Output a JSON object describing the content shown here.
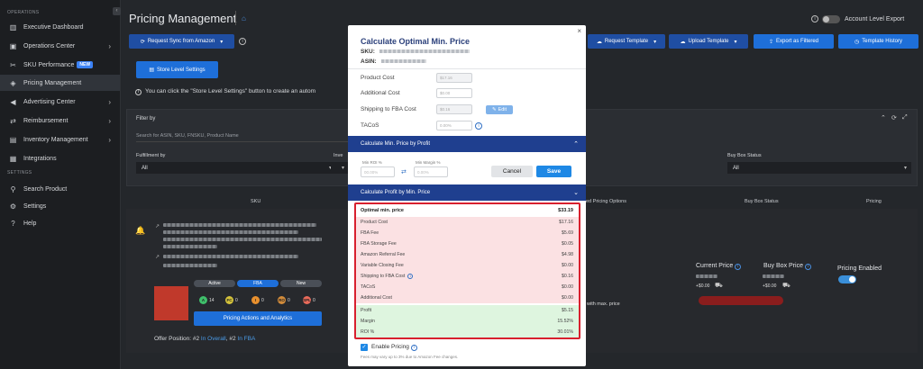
{
  "sidebar": {
    "section_operations": "OPERATIONS",
    "section_settings": "SETTINGS",
    "items": [
      {
        "label": "Executive Dashboard",
        "icon": "bar-chart-icon"
      },
      {
        "label": "Operations Center",
        "icon": "briefcase-icon"
      },
      {
        "label": "SKU Performance",
        "icon": "tag-icon",
        "badge": "NEW"
      },
      {
        "label": "Pricing Management",
        "icon": "price-tag-icon"
      },
      {
        "label": "Advertising Center",
        "icon": "megaphone-icon"
      },
      {
        "label": "Reimbursement",
        "icon": "exchange-icon"
      },
      {
        "label": "Inventory Management",
        "icon": "box-icon"
      },
      {
        "label": "Integrations",
        "icon": "grid-icon"
      },
      {
        "label": "Search Product",
        "icon": "search-icon"
      },
      {
        "label": "Settings",
        "icon": "gear-icon"
      },
      {
        "label": "Help",
        "icon": "question-icon"
      }
    ]
  },
  "header": {
    "title": "Pricing Management",
    "account_level_export": "Account Level Export",
    "request_sync": "Request Sync from Amazon",
    "request_template": "Request Template",
    "upload_template": "Upload Template",
    "export_filtered": "Export as Filtered",
    "template_history": "Template History",
    "store_level_settings": "Store Level Settings",
    "notice": "You can click the \"Store Level Settings\" button to create an autom"
  },
  "filter": {
    "title": "Filter by",
    "search_placeholder": "Search for ASIN, SKU, FNSKU, Product Name",
    "fulfillment_label": "Fulfillment by",
    "fulfillment_value": "All",
    "inventory_label": "Inve",
    "buybox_label": "Buy Box Status",
    "buybox_value": "All"
  },
  "table": {
    "col_sku": "SKU",
    "col_pricing_options": "ed Pricing Options",
    "col_buybox": "Buy Box Status",
    "col_pricing": "Pricing",
    "pill_active": "Active",
    "pill_fba": "FBA",
    "pill_new": "New",
    "stats": [
      {
        "letter": "A",
        "value": "14"
      },
      {
        "letter": "FC",
        "value": "0"
      },
      {
        "letter": "I",
        "value": "0"
      },
      {
        "letter": "RO",
        "value": "0"
      },
      {
        "letter": "SPL",
        "value": "0"
      }
    ],
    "pricing_actions": "Pricing Actions and Analytics",
    "offer_prefix": "Offer Position: ",
    "offer_rank1": "#2",
    "offer_in1": "In Overall",
    "offer_rank2": "#2",
    "offer_in2": "In FBA",
    "with_max_price": "with max. price",
    "current_price": "Current Price",
    "buy_box_price": "Buy Box Price",
    "pricing_enabled": "Pricing Enabled",
    "ship1": "+$0.00",
    "ship2": "+$0.00"
  },
  "modal": {
    "title": "Calculate Optimal Min. Price",
    "sku_label": "SKU:",
    "asin_label": "ASIN:",
    "fields": [
      {
        "label": "Product Cost",
        "value": "$17.16"
      },
      {
        "label": "Additional Cost",
        "value": "$0.00"
      },
      {
        "label": "Shipping to FBA Cost",
        "value": "$0.16"
      },
      {
        "label": "TACoS",
        "value": "0.00%"
      }
    ],
    "edit_label": "Edit",
    "section1": "Calculate Min. Price by Profit",
    "min_roi_label": "Min ROI %",
    "min_roi_value": "00.00%",
    "min_margin_label": "Min Margin %",
    "min_margin_value": "0.00%",
    "cancel": "Cancel",
    "save": "Save",
    "section2": "Calculate Profit by Min. Price",
    "results": [
      {
        "label": "Optimal min. price",
        "value": "$33.19",
        "style": "hdr"
      },
      {
        "label": "Product Cost",
        "value": "$17.16",
        "style": "pink"
      },
      {
        "label": "FBA Fee",
        "value": "$5.69",
        "style": "pink"
      },
      {
        "label": "FBA Storage Fee",
        "value": "$0.05",
        "style": "pink"
      },
      {
        "label": "Amazon Referral Fee",
        "value": "$4.98",
        "style": "pink"
      },
      {
        "label": "Variable Closing Fee",
        "value": "$0.00",
        "style": "pink"
      },
      {
        "label": "Shipping to FBA Cost",
        "value": "$0.16",
        "style": "pink",
        "info": true
      },
      {
        "label": "TACoS",
        "value": "$0.00",
        "style": "pink"
      },
      {
        "label": "Additional Cost",
        "value": "$0.00",
        "style": "pink"
      },
      {
        "label": "Profit",
        "value": "$5.15",
        "style": "green"
      },
      {
        "label": "Margin",
        "value": "15.52%",
        "style": "green"
      },
      {
        "label": "ROI %",
        "value": "30.01%",
        "style": "green"
      }
    ],
    "enable_pricing": "Enable Pricing",
    "footnote": "Fees may vary up to 3% due to Amazon Fee changes."
  }
}
